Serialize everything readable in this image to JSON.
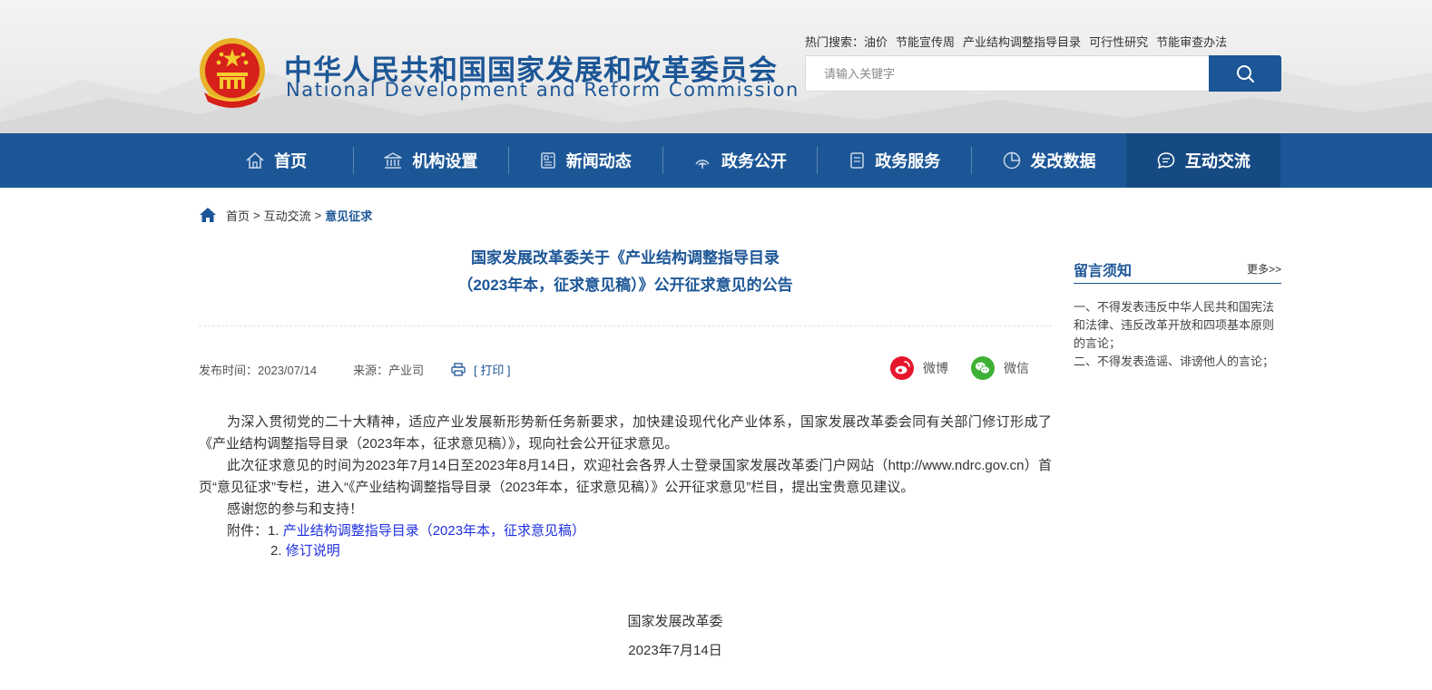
{
  "header": {
    "title_cn": "中华人民共和国国家发展和改革委员会",
    "title_en": "National Development and Reform Commission",
    "hot_search_label": "热门搜索：",
    "hot_search": [
      "油价",
      "节能宣传周",
      "产业结构调整指导目录",
      "可行性研究",
      "节能审查办法"
    ],
    "search_placeholder": "请输入关键字"
  },
  "nav": {
    "items": [
      {
        "label": "首页",
        "icon": "home-icon"
      },
      {
        "label": "机构设置",
        "icon": "institution-icon"
      },
      {
        "label": "新闻动态",
        "icon": "news-icon"
      },
      {
        "label": "政务公开",
        "icon": "broadcast-icon"
      },
      {
        "label": "政务服务",
        "icon": "document-icon"
      },
      {
        "label": "发改数据",
        "icon": "pie-chart-icon"
      },
      {
        "label": "互动交流",
        "icon": "chat-icon"
      }
    ],
    "active_index": 6
  },
  "breadcrumb": {
    "items": [
      "首页",
      "互动交流",
      "意见征求"
    ],
    "separator": ">"
  },
  "article": {
    "title_line1": "国家发展改革委关于《产业结构调整指导目录",
    "title_line2": "（2023年本，征求意见稿）》公开征求意见的公告",
    "publish_time": "发布时间：2023/07/14",
    "source": "来源：产业司",
    "print_label": "[ 打印 ]",
    "share_weibo": "微博",
    "share_wechat": "微信",
    "para1": "为深入贯彻党的二十大精神，适应产业发展新形势新任务新要求，加快建设现代化产业体系，国家发展改革委会同有关部门修订形成了《产业结构调整指导目录（2023年本，征求意见稿）》，现向社会公开征求意见。",
    "para2": "此次征求意见的时间为2023年7月14日至2023年8月14日，欢迎社会各界人士登录国家发展改革委门户网站（http://www.ndrc.gov.cn）首页“意见征求”专栏，进入“《产业结构调整指导目录（2023年本，征求意见稿）》公开征求意见”栏目，提出宝贵意见建议。",
    "para3": "感谢您的参与和支持！",
    "attach_prefix": "附件：1. ",
    "attach1": "产业结构调整指导目录（2023年本，征求意见稿）",
    "attach2_prefix": "2. ",
    "attach2": "修订说明",
    "sign_org": "国家发展改革委",
    "sign_date": "2023年7月14日"
  },
  "sidebar": {
    "title": "留言须知",
    "more": "更多>>",
    "rule1": "一、不得发表违反中华人民共和国宪法和法律、违反改革开放和四项基本原则的言论；",
    "rule2": "二、不得发表造谣、诽谤他人的言论；"
  },
  "colors": {
    "brand_blue": "#1c5696",
    "link_blue": "#1f2fe0",
    "weibo_red": "#e6162d",
    "wechat_green": "#3eb135"
  }
}
